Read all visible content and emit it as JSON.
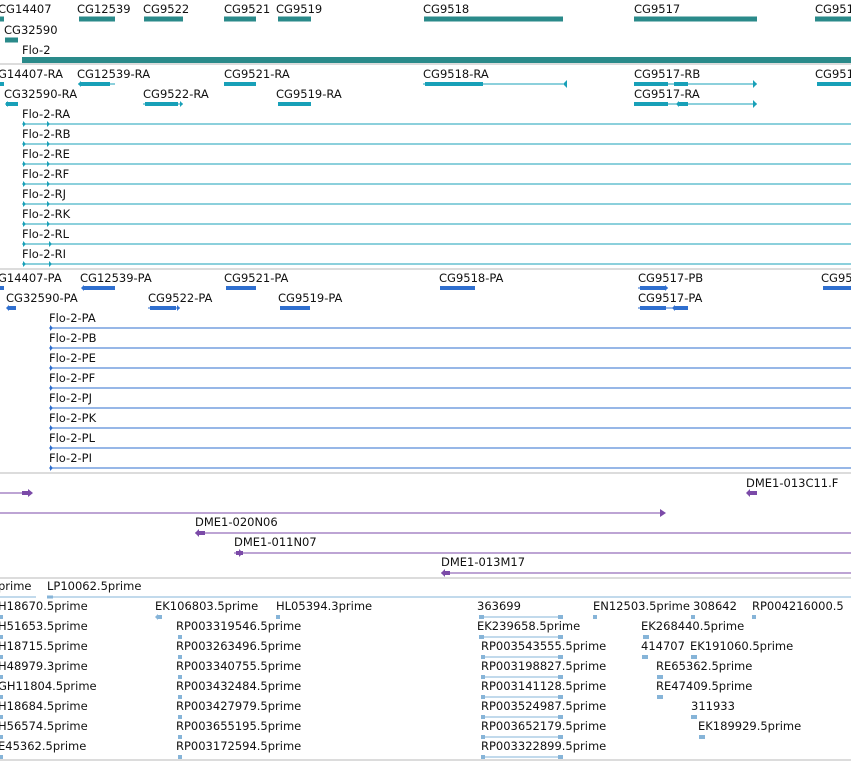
{
  "colors": {
    "gene": "#2a8a8a",
    "transcript": "#18a0b8",
    "protein": "#2f6fcf",
    "clone": "#7b4aa8",
    "est": "#86b4d8",
    "divider": "#b8b8b8"
  },
  "icons": {
    "arrow_start": "triangle-left",
    "arrow_end": "triangle-right"
  },
  "tracks": {
    "genes": {
      "features": [
        {
          "label": "CG14407"
        },
        {
          "label": "CG12539"
        },
        {
          "label": "CG9522"
        },
        {
          "label": "CG9521"
        },
        {
          "label": "CG9519"
        },
        {
          "label": "CG9518"
        },
        {
          "label": "CG9517"
        },
        {
          "label": "CG951"
        },
        {
          "label": "CG32590"
        },
        {
          "label": "Flo-2"
        }
      ]
    },
    "transcripts": {
      "features": [
        {
          "label": "G14407-RA"
        },
        {
          "label": "CG12539-RA"
        },
        {
          "label": "CG9521-RA"
        },
        {
          "label": "CG9518-RA"
        },
        {
          "label": "CG9517-RB"
        },
        {
          "label": "CG951"
        },
        {
          "label": "CG32590-RA"
        },
        {
          "label": "CG9522-RA"
        },
        {
          "label": "CG9519-RA"
        },
        {
          "label": "CG9517-RA"
        },
        {
          "label": "Flo-2-RA"
        },
        {
          "label": "Flo-2-RB"
        },
        {
          "label": "Flo-2-RE"
        },
        {
          "label": "Flo-2-RF"
        },
        {
          "label": "Flo-2-RJ"
        },
        {
          "label": "Flo-2-RK"
        },
        {
          "label": "Flo-2-RL"
        },
        {
          "label": "Flo-2-RI"
        }
      ]
    },
    "proteins": {
      "features": [
        {
          "label": "G14407-PA"
        },
        {
          "label": "CG12539-PA"
        },
        {
          "label": "CG9521-PA"
        },
        {
          "label": "CG9518-PA"
        },
        {
          "label": "CG9517-PB"
        },
        {
          "label": "CG95"
        },
        {
          "label": "CG32590-PA"
        },
        {
          "label": "CG9522-PA"
        },
        {
          "label": "CG9519-PA"
        },
        {
          "label": "CG9517-PA"
        },
        {
          "label": "Flo-2-PA"
        },
        {
          "label": "Flo-2-PB"
        },
        {
          "label": "Flo-2-PE"
        },
        {
          "label": "Flo-2-PF"
        },
        {
          "label": "Flo-2-PJ"
        },
        {
          "label": "Flo-2-PK"
        },
        {
          "label": "Flo-2-PL"
        },
        {
          "label": "Flo-2-PI"
        }
      ]
    },
    "clones": {
      "features": [
        {
          "label": "DME1-013C11.F"
        },
        {
          "label": "DME1-020N06"
        },
        {
          "label": "DME1-011N07"
        },
        {
          "label": "DME1-013M17"
        }
      ]
    },
    "ests": {
      "features": [
        {
          "label": "prime"
        },
        {
          "label": "LP10062.5prime"
        },
        {
          "label": "H18670.5prime"
        },
        {
          "label": "EK106803.5prime"
        },
        {
          "label": "HL05394.3prime"
        },
        {
          "label": "363699"
        },
        {
          "label": "EN12503.5prime"
        },
        {
          "label": "308642"
        },
        {
          "label": "RP004216000.5"
        },
        {
          "label": "H51653.5prime"
        },
        {
          "label": "RP003319546.5prime"
        },
        {
          "label": "EK239658.5prime"
        },
        {
          "label": "EK268440.5prime"
        },
        {
          "label": "H18715.5prime"
        },
        {
          "label": "RP003263496.5prime"
        },
        {
          "label": "RP003543555.5prime"
        },
        {
          "label": "414707"
        },
        {
          "label": "EK191060.5prime"
        },
        {
          "label": "H48979.3prime"
        },
        {
          "label": "RP003340755.5prime"
        },
        {
          "label": "RP003198827.5prime"
        },
        {
          "label": "RE65362.5prime"
        },
        {
          "label": "GH11804.5prime"
        },
        {
          "label": "RP003432484.5prime"
        },
        {
          "label": "RP003141128.5prime"
        },
        {
          "label": "RE47409.5prime"
        },
        {
          "label": "H18684.5prime"
        },
        {
          "label": "RP003427979.5prime"
        },
        {
          "label": "RP003524987.5prime"
        },
        {
          "label": "311933"
        },
        {
          "label": "H56574.5prime"
        },
        {
          "label": "RP003655195.5prime"
        },
        {
          "label": "RP003652179.5prime"
        },
        {
          "label": "EK189929.5prime"
        },
        {
          "label": "E45362.5prime"
        },
        {
          "label": "RP003172594.5prime"
        },
        {
          "label": "RP003322899.5prime"
        }
      ]
    }
  }
}
